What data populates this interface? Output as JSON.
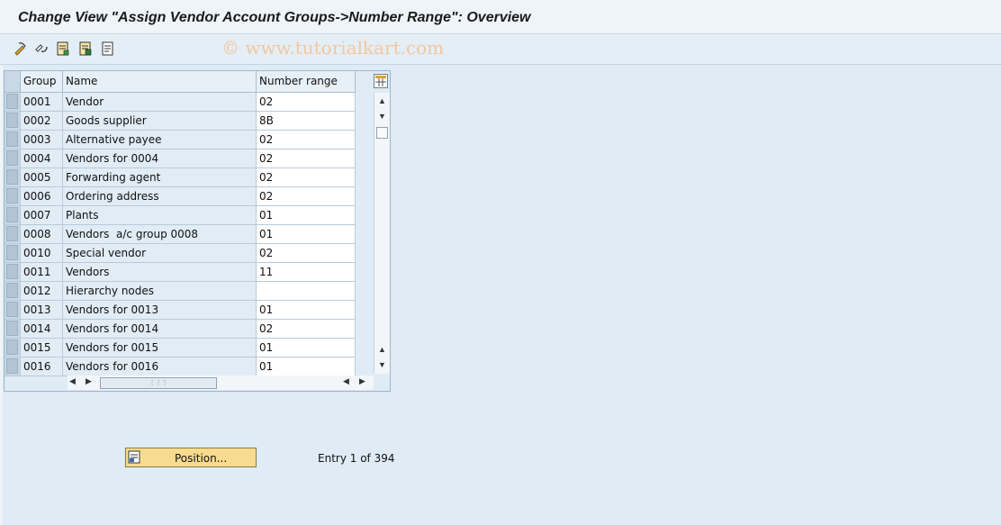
{
  "window": {
    "title": "Change View \"Assign Vendor Account Groups->Number Range\": Overview",
    "watermark": "© www.tutorialkart.com"
  },
  "toolbar": {
    "buttons": [
      "display-change-icon",
      "other-view-icon",
      "new-entries-icon",
      "copy-as-icon",
      "delete-icon"
    ]
  },
  "table": {
    "headers": {
      "group": "Group",
      "name": "Name",
      "number_range": "Number range"
    },
    "rows": [
      {
        "group": "0001",
        "name": "Vendor",
        "nr": "02"
      },
      {
        "group": "0002",
        "name": "Goods supplier",
        "nr": "8B"
      },
      {
        "group": "0003",
        "name": "Alternative payee",
        "nr": "02"
      },
      {
        "group": "0004",
        "name": "Vendors for 0004",
        "nr": "02"
      },
      {
        "group": "0005",
        "name": "Forwarding agent",
        "nr": "02"
      },
      {
        "group": "0006",
        "name": "Ordering address",
        "nr": "02"
      },
      {
        "group": "0007",
        "name": "Plants",
        "nr": "01"
      },
      {
        "group": "0008",
        "name": "Vendors  a/c group 0008",
        "nr": "01"
      },
      {
        "group": "0010",
        "name": "Special vendor",
        "nr": "02"
      },
      {
        "group": "0011",
        "name": "Vendors",
        "nr": "11"
      },
      {
        "group": "0012",
        "name": "Hierarchy nodes",
        "nr": ""
      },
      {
        "group": "0013",
        "name": "Vendors for 0013",
        "nr": "01"
      },
      {
        "group": "0014",
        "name": "Vendors for 0014",
        "nr": "02"
      },
      {
        "group": "0015",
        "name": "Vendors for 0015",
        "nr": "01"
      },
      {
        "group": "0016",
        "name": "Vendors for 0016",
        "nr": "01"
      }
    ]
  },
  "footer": {
    "position_label": "Position...",
    "entry_text": "Entry 1 of 394"
  }
}
